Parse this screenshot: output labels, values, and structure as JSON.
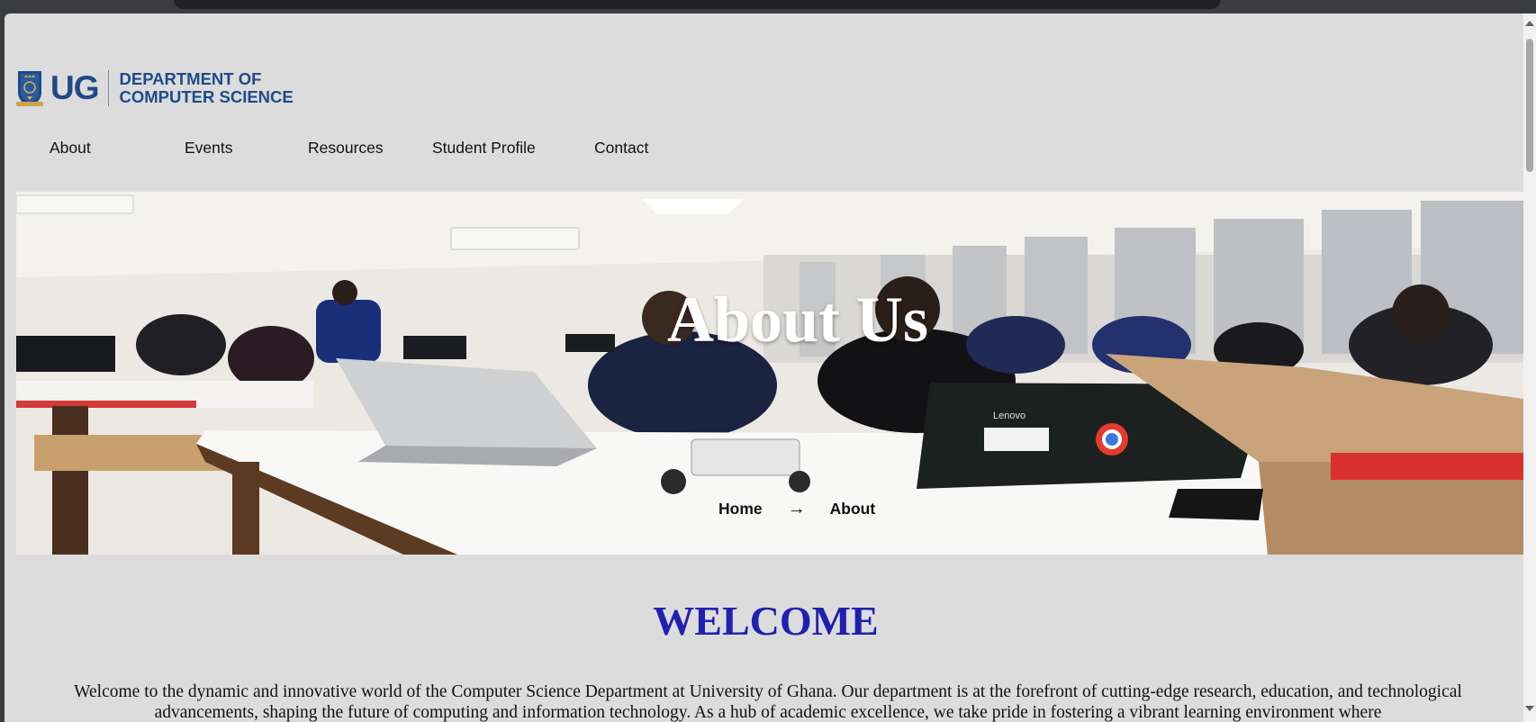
{
  "logo": {
    "short": "UG",
    "line1": "DEPARTMENT OF",
    "line2": "COMPUTER SCIENCE"
  },
  "nav": {
    "items": [
      {
        "label": "About"
      },
      {
        "label": "Events"
      },
      {
        "label": "Resources"
      },
      {
        "label": "Student Profile"
      },
      {
        "label": "Contact"
      }
    ]
  },
  "hero": {
    "title": "About Us",
    "laptop_brand": "Lenovo",
    "breadcrumb": {
      "home": "Home",
      "separator": "→",
      "current": "About"
    }
  },
  "welcome": {
    "title": "WELCOME",
    "text": "Welcome to the dynamic and innovative world of the Computer Science Department at University of Ghana. Our department is at the forefront of cutting-edge research, education, and technological advancements, shaping the future of computing and information technology. As a hub of academic excellence, we take pride in fostering a vibrant learning environment where"
  },
  "colors": {
    "page_background": "#dcdcdc",
    "logo_blue": "#1f4a8a",
    "welcome_blue": "#2020b0"
  }
}
